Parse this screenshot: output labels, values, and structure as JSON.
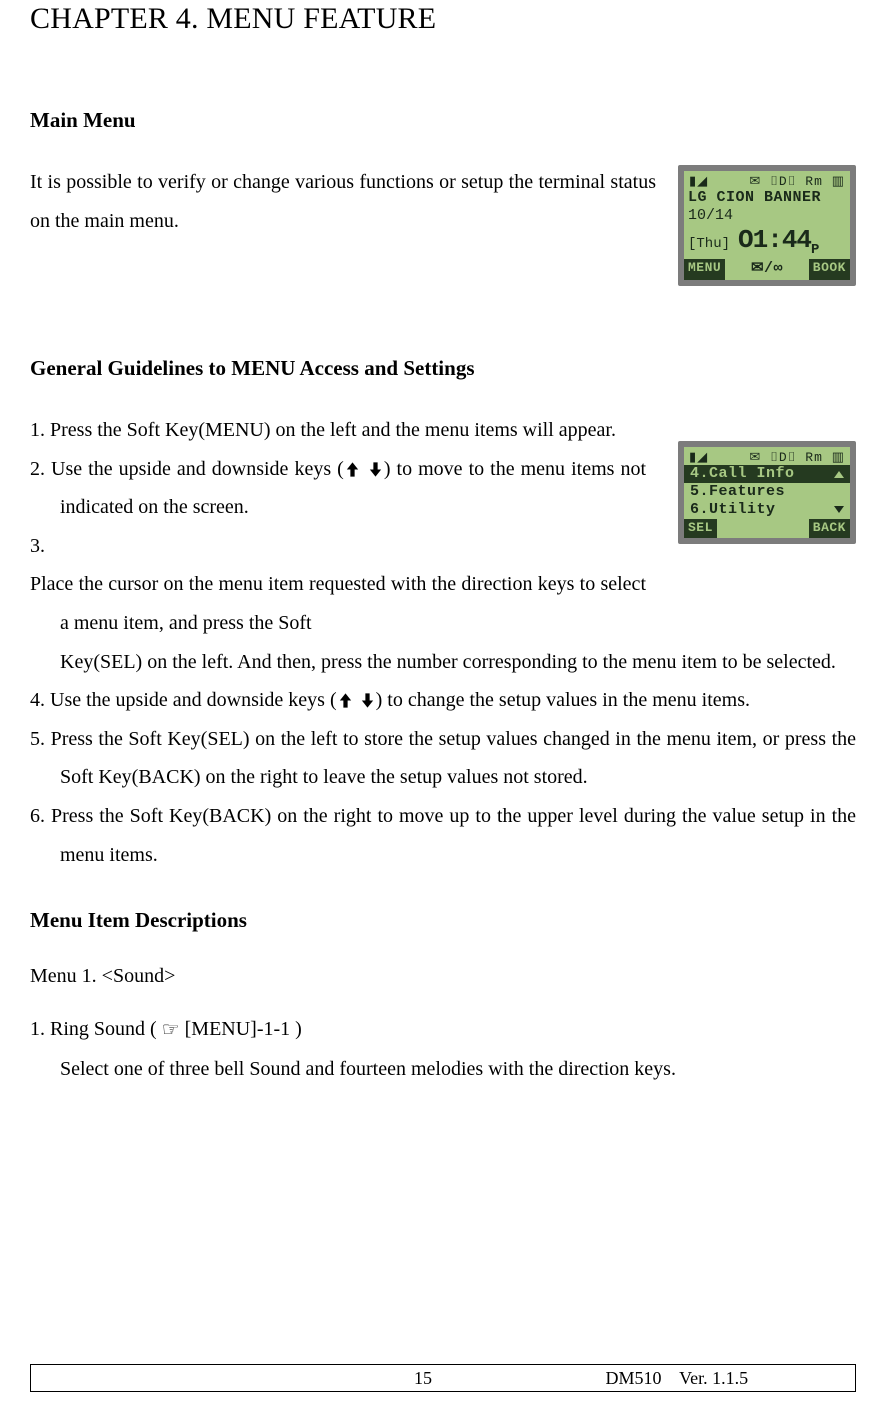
{
  "chapter_title": "CHAPTER 4. MENU FEATURE",
  "sections": {
    "main_menu": {
      "heading": "Main Menu",
      "text": "It is possible to verify or change various functions or setup the terminal status on the main menu."
    },
    "guidelines": {
      "heading": "General Guidelines to MENU Access and Settings",
      "items_pre": [
        "Press the Soft Key(MENU) on the left and the menu items will appear.",
        "Use the upside and downside keys (",
        "Place the cursor on the menu item requested with the direction keys to select a menu item, and press the Soft "
      ],
      "item2_post": ") to move to the menu items not indicated on the screen.",
      "item3_cont": "Key(SEL) on the left. And then, press the number corresponding to the menu item to be selected.",
      "item4_pre": "Use the upside and downside keys (",
      "item4_post": ") to change the setup values in the menu items.",
      "item5": "Press the Soft Key(SEL) on the left to store the setup values changed in the menu item, or press the Soft Key(BACK) on the right to leave the setup values not stored.",
      "item6": "Press the Soft Key(BACK) on the right to move up to the upper level during the value setup in the menu items."
    },
    "descriptions": {
      "heading": "Menu Item Descriptions",
      "menu1_label": "Menu 1.    <Sound>",
      "ring_title_pre": "1.   Ring Sound ( ",
      "ring_title_post": " [MENU]-1-1 )",
      "ring_desc": "Select one of three bell Sound and fourteen melodies with the direction keys."
    }
  },
  "lcd1": {
    "status_left": "▮◢",
    "status_right": "✉ ⌷D⌷ Rm ▥",
    "banner": "LG CION BANNER",
    "date": "10/14",
    "day": "[Thu]",
    "time": "O1:44",
    "ampm": "P",
    "soft_left": "MENU",
    "soft_mid": "✉/∞",
    "soft_right": "BOOK"
  },
  "lcd2": {
    "status_left": "▮◢",
    "status_right": "✉ ⌷D⌷ Rm ▥",
    "row1": "4.Call Info",
    "row2": "5.Features",
    "row3": "6.Utility",
    "soft_left": "SEL",
    "soft_right": "BACK"
  },
  "footer": {
    "page_num": "15",
    "doc_id": "DM510    Ver. 1.1.5"
  }
}
